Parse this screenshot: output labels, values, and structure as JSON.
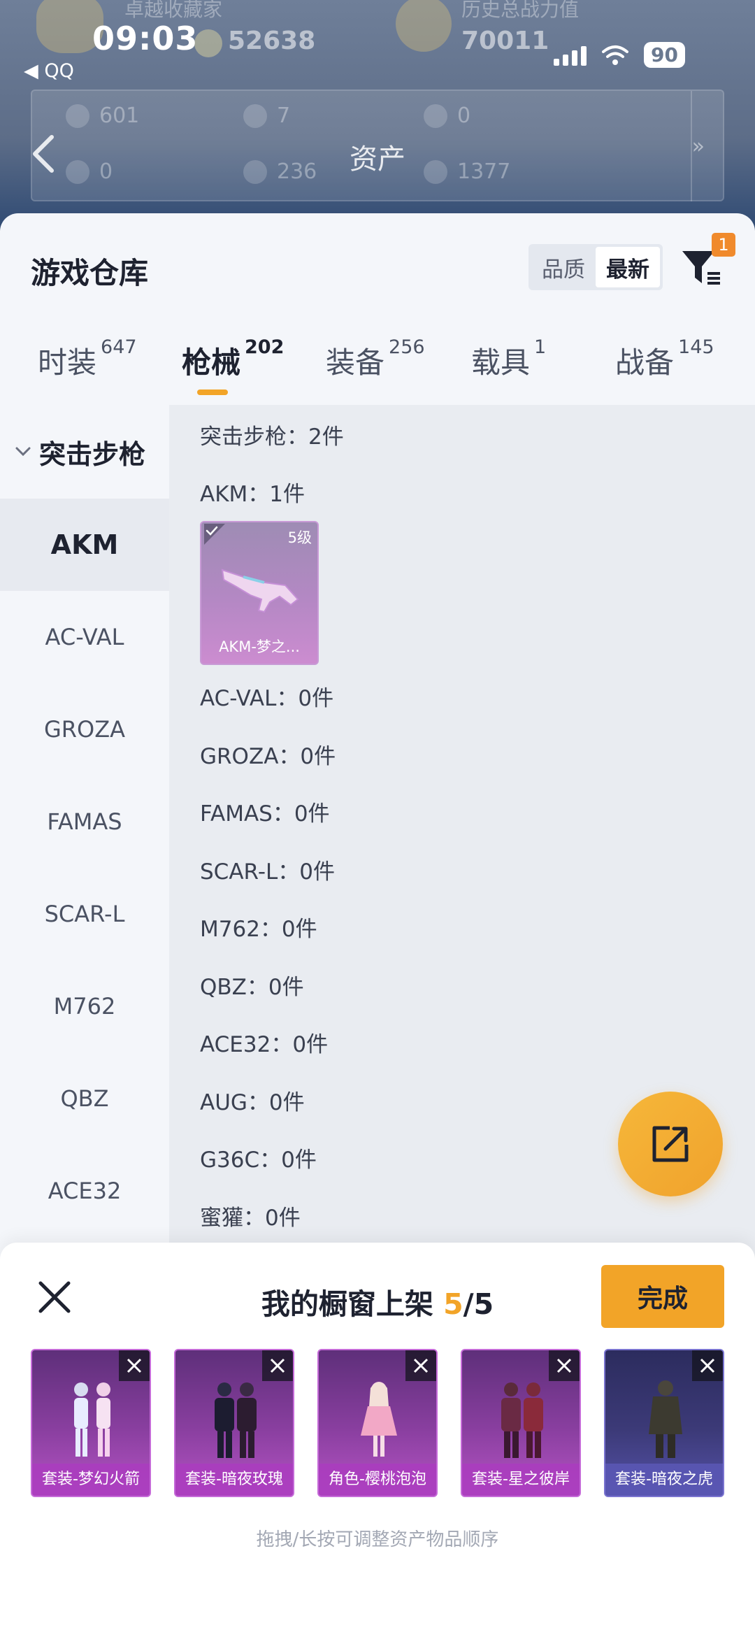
{
  "status_bar": {
    "time": "09:03",
    "back_app": "◀ QQ",
    "battery": "90"
  },
  "background": {
    "top_left_text": "卓越收藏家",
    "top_right_text": "历史总战力值",
    "stat_1": "52638",
    "stat_2": "70011",
    "page_title": "资产",
    "more": "»",
    "assets": [
      "601",
      "7",
      "0",
      "0",
      "236",
      "1377"
    ]
  },
  "warehouse": {
    "title": "游戏仓库",
    "sort_options": [
      "品质",
      "最新"
    ],
    "sort_selected": "最新",
    "filter_badge": "1",
    "tabs": [
      {
        "label": "时装",
        "count": "647"
      },
      {
        "label": "枪械",
        "count": "202"
      },
      {
        "label": "装备",
        "count": "256"
      },
      {
        "label": "载具",
        "count": "1"
      },
      {
        "label": "战备",
        "count": "145"
      }
    ],
    "active_tab": "枪械",
    "sidebar": {
      "group": "突击步枪",
      "items": [
        "AKM",
        "AC-VAL",
        "GROZA",
        "FAMAS",
        "SCAR-L",
        "M762",
        "QBZ",
        "ACE32"
      ],
      "active": "AKM"
    },
    "list": {
      "group_summary": "突击步枪：2件",
      "rows": [
        "AKM：1件",
        "AC-VAL：0件",
        "GROZA：0件",
        "FAMAS：0件",
        "SCAR-L：0件",
        "M762：0件",
        "QBZ：0件",
        "ACE32：0件",
        "AUG：0件",
        "G36C：0件",
        "蜜獾：0件"
      ],
      "item": {
        "name": "AKM-梦之...",
        "level": "5级"
      }
    }
  },
  "showcase": {
    "title_prefix": "我的橱窗上架 ",
    "current": "5",
    "total": "/5",
    "done_label": "完成",
    "slots": [
      "套装-梦幻火箭",
      "套装-暗夜玫瑰",
      "角色-樱桃泡泡",
      "套装-星之彼岸",
      "套装-暗夜之虎"
    ],
    "hint": "拖拽/长按可调整资产物品顺序"
  }
}
